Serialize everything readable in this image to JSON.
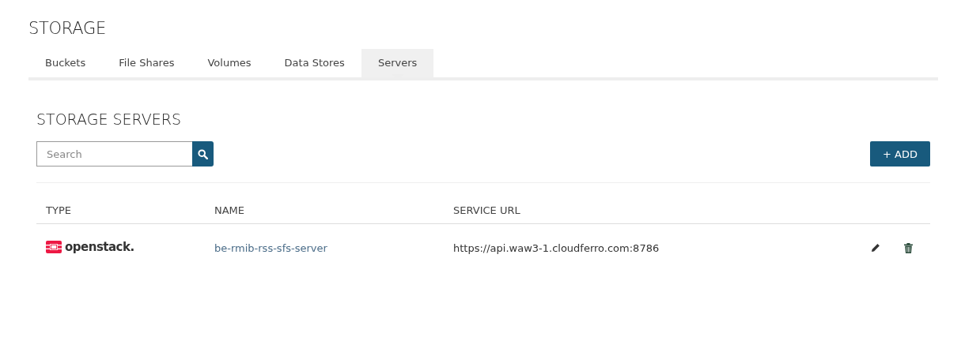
{
  "page_title": "STORAGE",
  "tabs": [
    {
      "label": "Buckets",
      "selected": false
    },
    {
      "label": "File Shares",
      "selected": false
    },
    {
      "label": "Volumes",
      "selected": false
    },
    {
      "label": "Data Stores",
      "selected": false
    },
    {
      "label": "Servers",
      "selected": true
    }
  ],
  "section_title": "STORAGE SERVERS",
  "search": {
    "placeholder": "Search"
  },
  "add_button": "+ ADD",
  "table": {
    "columns": [
      "TYPE",
      "NAME",
      "SERVICE URL"
    ],
    "rows": [
      {
        "type": "openstack.",
        "name": "be-rmib-rss-sfs-server",
        "service_url": "https://api.waw3-1.cloudferro.com:8786"
      }
    ]
  }
}
